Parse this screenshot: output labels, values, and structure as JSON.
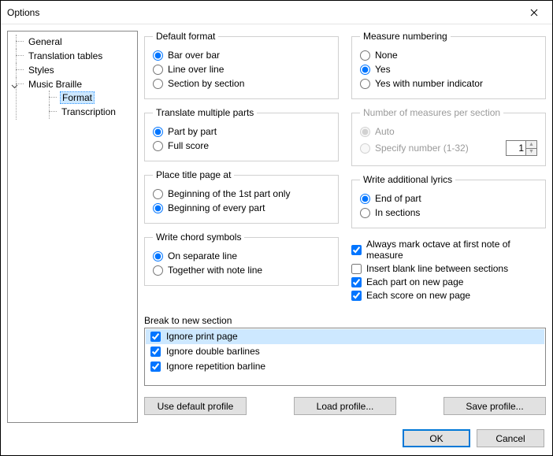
{
  "window": {
    "title": "Options"
  },
  "tree": {
    "items": [
      "General",
      "Translation tables",
      "Styles",
      "Music Braille"
    ],
    "sub": [
      "Format",
      "Transcription"
    ],
    "selected": "Format"
  },
  "defaultFormat": {
    "legend": "Default format",
    "opts": [
      "Bar over bar",
      "Line over line",
      "Section by section"
    ],
    "value": "Bar over bar"
  },
  "translateParts": {
    "legend": "Translate multiple parts",
    "opts": [
      "Part by part",
      "Full score"
    ],
    "value": "Part by part"
  },
  "titlePage": {
    "legend": "Place title page at",
    "opts": [
      "Beginning of the 1st part only",
      "Beginning of every part"
    ],
    "value": "Beginning of every part"
  },
  "chordSymbols": {
    "legend": "Write chord symbols",
    "opts": [
      "On separate line",
      "Together with note line"
    ],
    "value": "On separate line"
  },
  "measureNumbering": {
    "legend": "Measure numbering",
    "opts": [
      "None",
      "Yes",
      "Yes with number indicator"
    ],
    "value": "Yes"
  },
  "measuresPerSection": {
    "legend": "Number of measures per section",
    "auto": "Auto",
    "specify": "Specify number (1-32)",
    "value": "Auto",
    "number": "1"
  },
  "additionalLyrics": {
    "legend": "Write additional lyrics",
    "opts": [
      "End of part",
      "In sections"
    ],
    "value": "End of part"
  },
  "checks": {
    "items": [
      {
        "label": "Always mark octave at first note of measure",
        "checked": true
      },
      {
        "label": "Insert blank line between sections",
        "checked": false
      },
      {
        "label": "Each part on new page",
        "checked": true
      },
      {
        "label": "Each score on new page",
        "checked": true
      }
    ]
  },
  "breakSection": {
    "label": "Break to new section",
    "items": [
      {
        "label": "Ignore print page",
        "checked": true,
        "selected": true
      },
      {
        "label": "Ignore double barlines",
        "checked": true,
        "selected": false
      },
      {
        "label": "Ignore repetition barline",
        "checked": true,
        "selected": false
      }
    ]
  },
  "buttons": {
    "defaultProfile": "Use default profile",
    "loadProfile": "Load profile...",
    "saveProfile": "Save profile...",
    "ok": "OK",
    "cancel": "Cancel"
  }
}
